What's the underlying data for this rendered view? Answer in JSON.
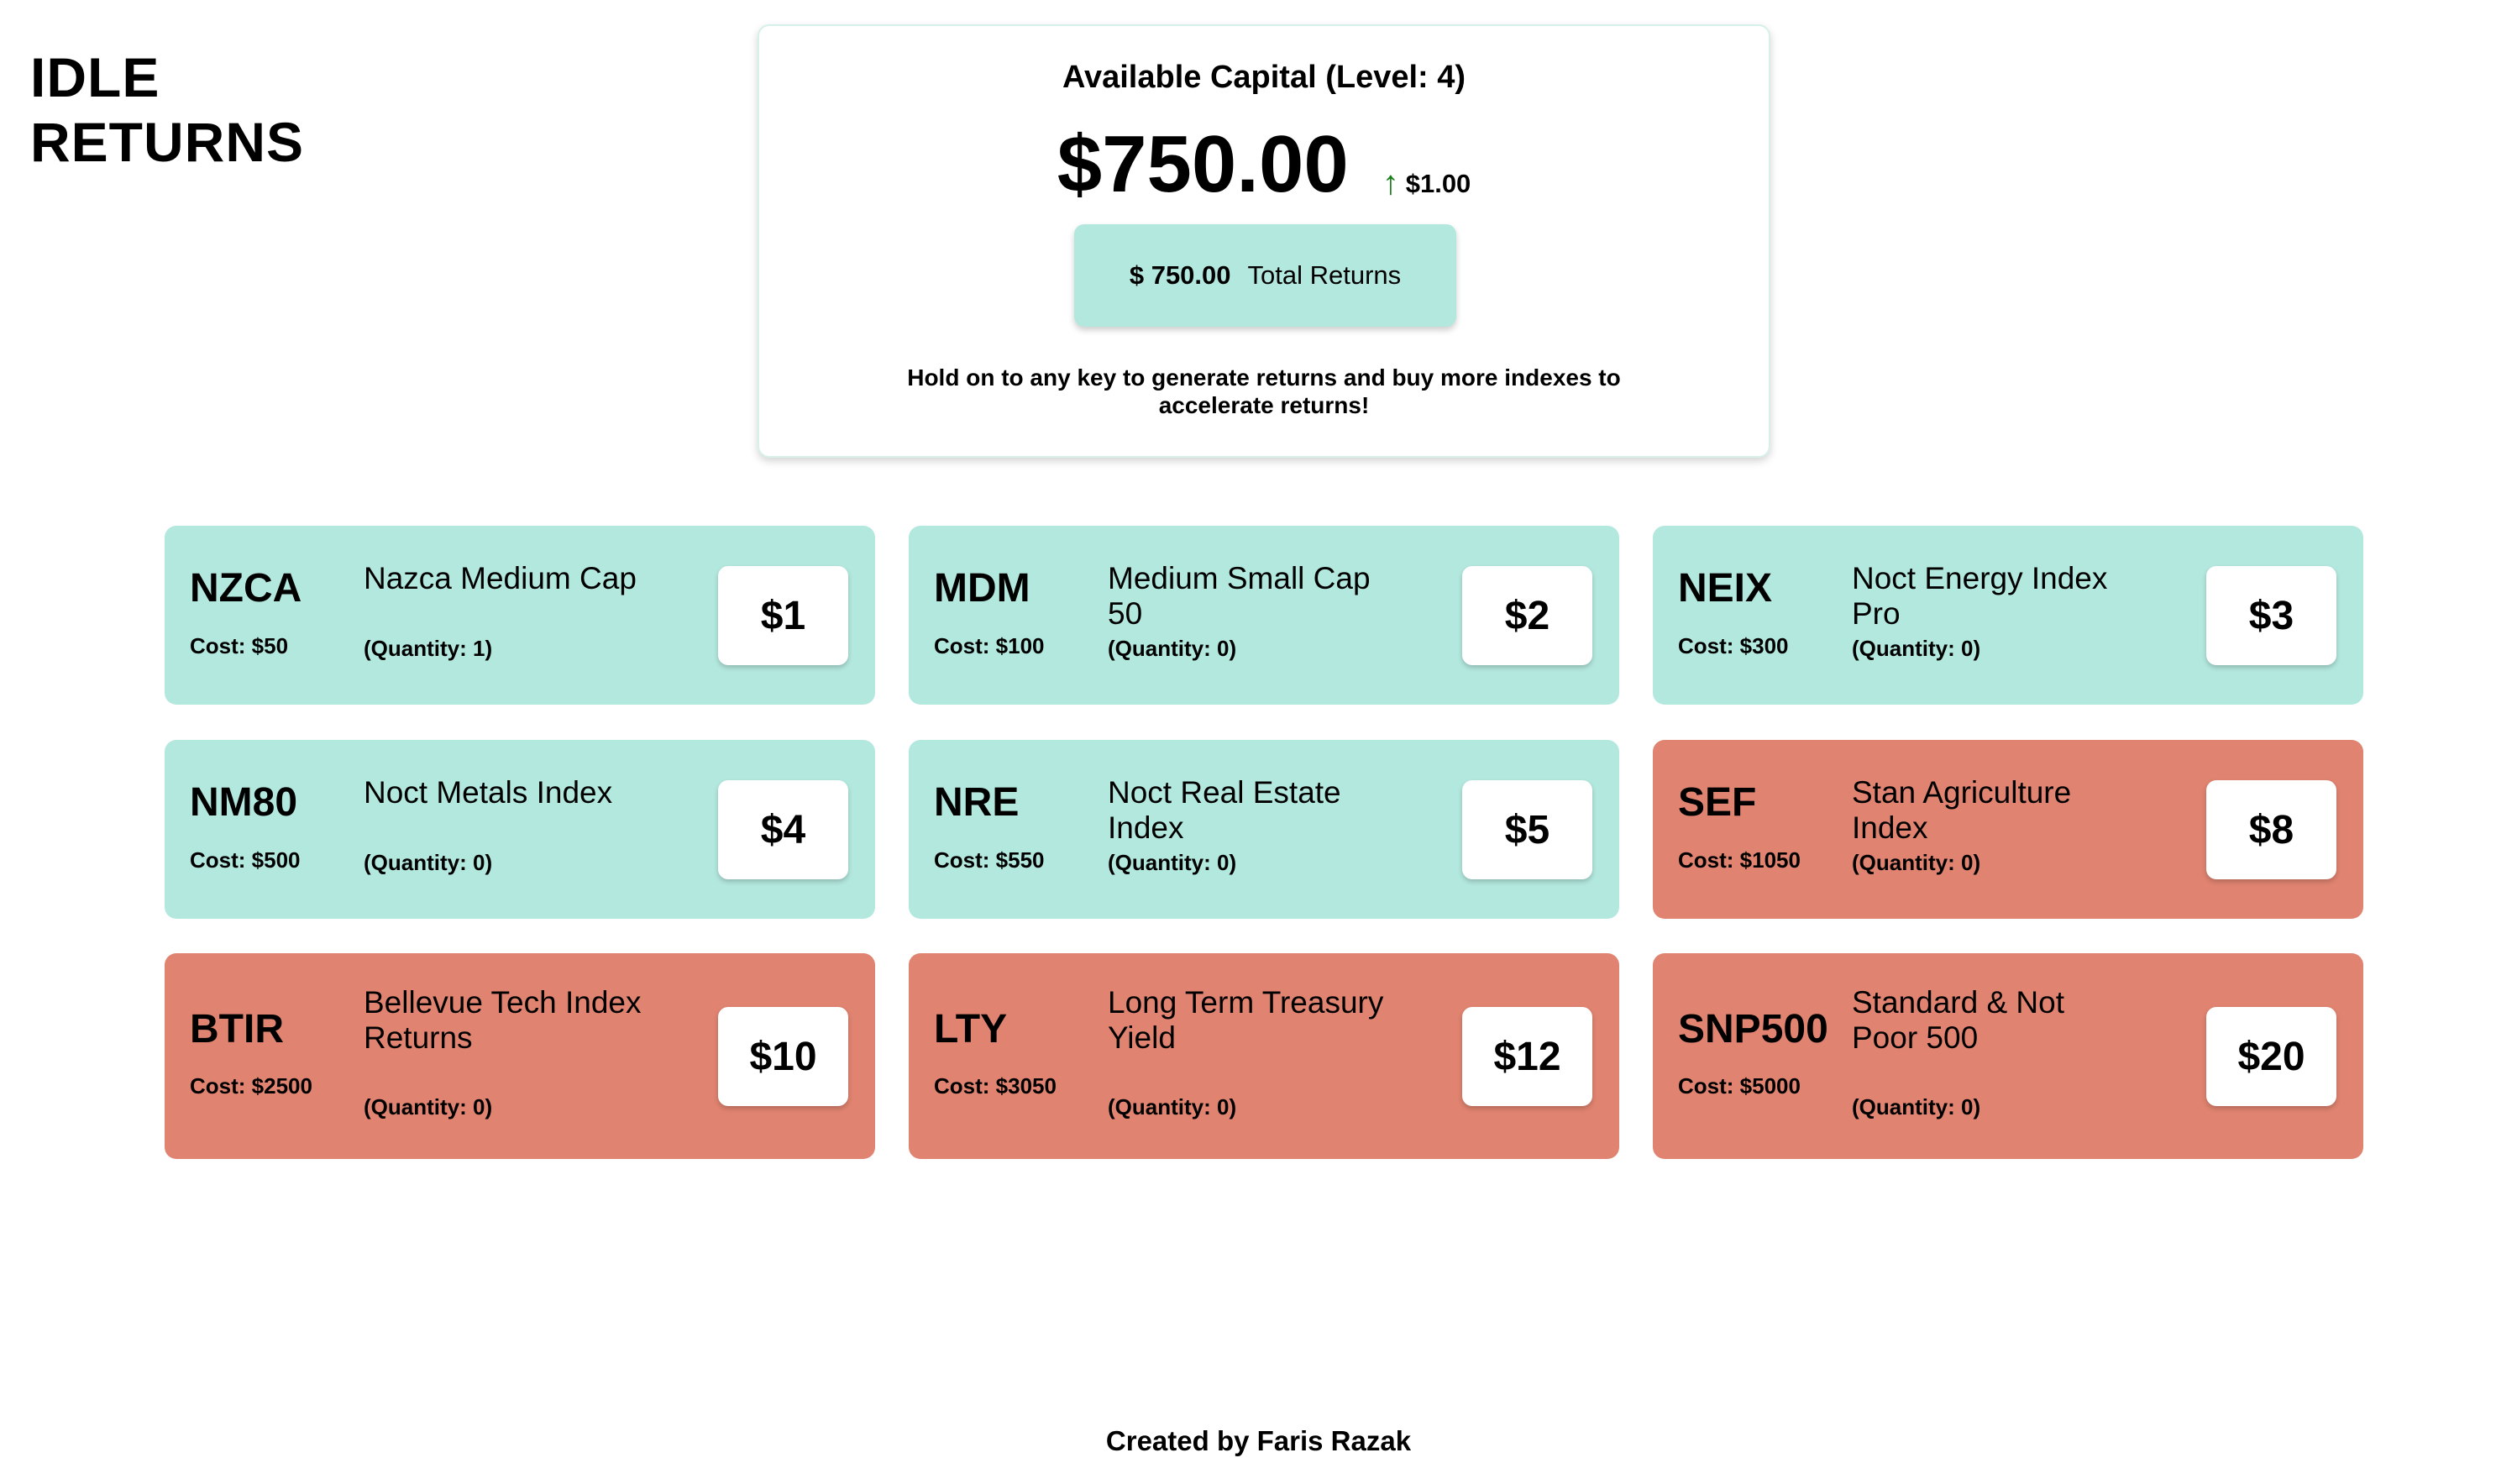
{
  "app": {
    "title_line1": "IDLE",
    "title_line2": "RETURNS"
  },
  "capital": {
    "title": "Available Capital (Level: 4)",
    "amount": "$750.00",
    "rate_icon": "up-arrow-icon",
    "rate": "$1.00",
    "total_returns_amount": "$ 750.00",
    "total_returns_label": "Total Returns",
    "hint": "Hold on to any key to generate returns and buy more indexes to accelerate returns!"
  },
  "colors": {
    "affordable": "#b3e8de",
    "locked": "#e08370",
    "rate_arrow": "#1a7f1a"
  },
  "indexes": [
    {
      "symbol": "NZCA",
      "name": "Nazca Medium Cap",
      "cost": "Cost: $50",
      "quantity": "(Quantity: 1)",
      "rate": "$1",
      "status": "affordable"
    },
    {
      "symbol": "MDM",
      "name": "Medium Small Cap 50",
      "cost": "Cost: $100",
      "quantity": "(Quantity: 0)",
      "rate": "$2",
      "status": "affordable"
    },
    {
      "symbol": "NEIX",
      "name": "Noct Energy Index Pro",
      "cost": "Cost: $300",
      "quantity": "(Quantity: 0)",
      "rate": "$3",
      "status": "affordable"
    },
    {
      "symbol": "NM80",
      "name": "Noct Metals Index",
      "cost": "Cost: $500",
      "quantity": "(Quantity: 0)",
      "rate": "$4",
      "status": "affordable"
    },
    {
      "symbol": "NRE",
      "name": "Noct Real Estate Index",
      "cost": "Cost: $550",
      "quantity": "(Quantity: 0)",
      "rate": "$5",
      "status": "affordable"
    },
    {
      "symbol": "SEF",
      "name": "Stan Agriculture Index",
      "cost": "Cost: $1050",
      "quantity": "(Quantity: 0)",
      "rate": "$8",
      "status": "locked"
    },
    {
      "symbol": "BTIR",
      "name": "Bellevue Tech Index Returns",
      "cost": "Cost: $2500",
      "quantity": "(Quantity: 0)",
      "rate": "$10",
      "status": "locked"
    },
    {
      "symbol": "LTY",
      "name": "Long Term Treasury Yield",
      "cost": "Cost: $3050",
      "quantity": "(Quantity: 0)",
      "rate": "$12",
      "status": "locked"
    },
    {
      "symbol": "SNP500",
      "name": "Standard & Not Poor 500",
      "cost": "Cost: $5000",
      "quantity": "(Quantity: 0)",
      "rate": "$20",
      "status": "locked"
    }
  ],
  "footer": {
    "credit": "Created by Faris Razak"
  }
}
